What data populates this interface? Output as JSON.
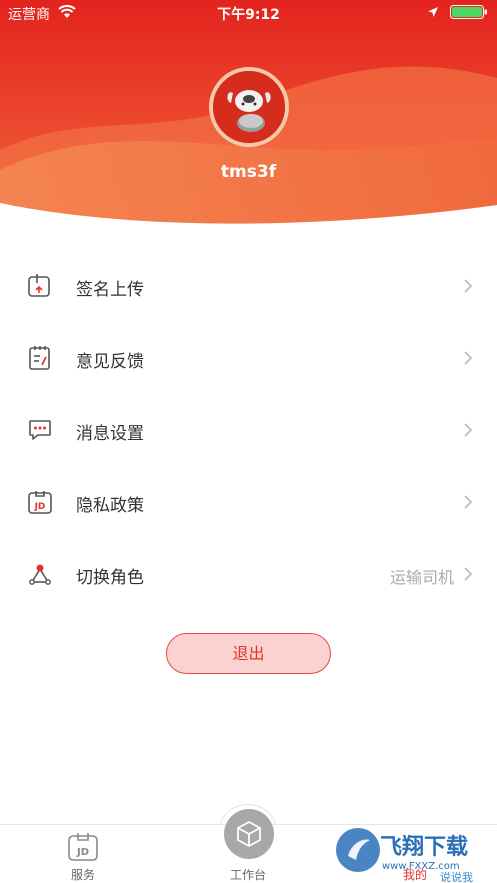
{
  "status_bar": {
    "carrier": "运营商",
    "time": "下午9:12"
  },
  "profile": {
    "username": "tms3f"
  },
  "menu": {
    "items": [
      {
        "label": "签名上传",
        "icon": "signature-upload-icon"
      },
      {
        "label": "意见反馈",
        "icon": "feedback-icon"
      },
      {
        "label": "消息设置",
        "icon": "message-icon"
      },
      {
        "label": "隐私政策",
        "icon": "privacy-jd-icon"
      },
      {
        "label": "切换角色",
        "icon": "switch-role-icon",
        "value": "运输司机"
      }
    ]
  },
  "logout_label": "退出",
  "tabbar": {
    "tabs": [
      {
        "label": "服务",
        "icon": "service-jd-icon"
      },
      {
        "label": "工作台",
        "icon": "workbench-cube-icon"
      },
      {
        "label": "我的"
      }
    ]
  },
  "watermark": {
    "text": "飞翔下载",
    "url": "www.FXXZ.com",
    "slogan": "说说我"
  },
  "colors": {
    "brand_red": "#e0352b",
    "header_red": "#e63b24",
    "header_orange": "#f57a45"
  }
}
